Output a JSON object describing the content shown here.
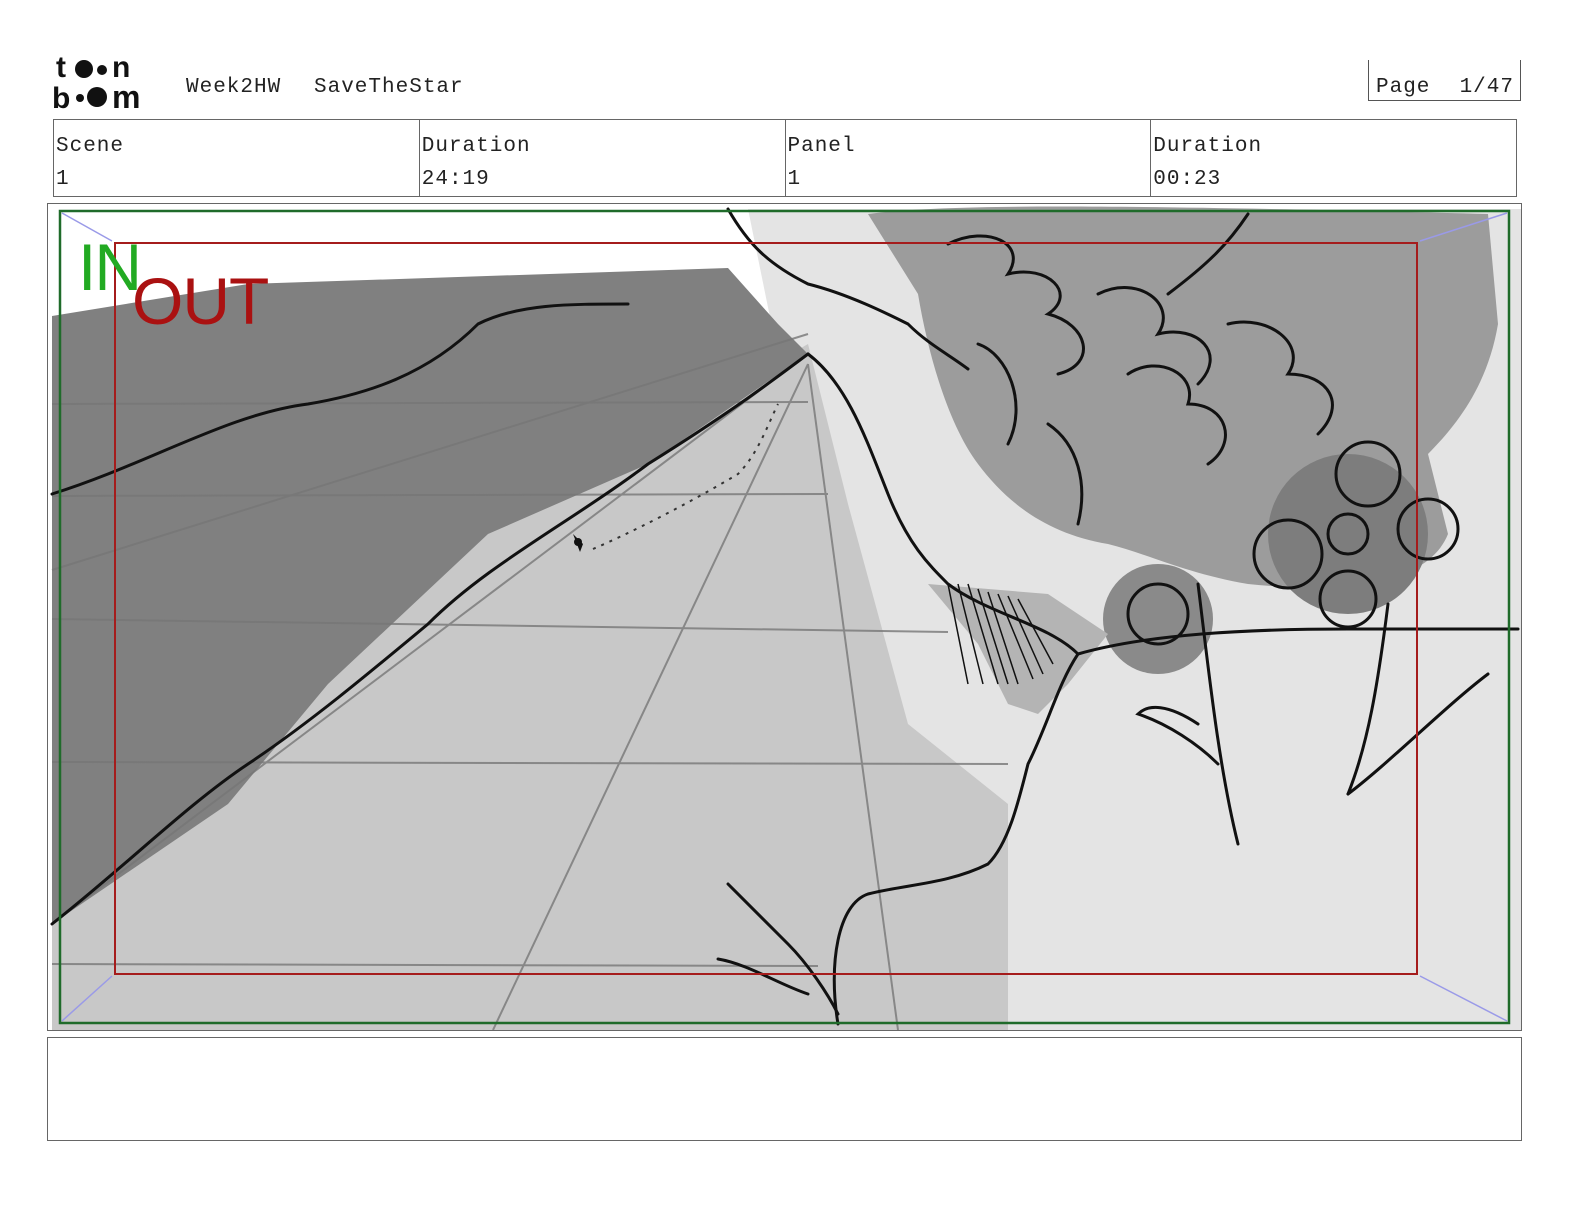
{
  "header": {
    "logo_text_top": "toon",
    "logo_text_bottom": "boom",
    "project": "Week2HW",
    "scene_name": "SaveTheStar",
    "page_label": "Page",
    "page_value": "1/47"
  },
  "info": {
    "scene_label": "Scene",
    "scene_value": "1",
    "scene_duration_label": "Duration",
    "scene_duration_value": "24:19",
    "panel_label": "Panel",
    "panel_value": "1",
    "panel_duration_label": "Duration",
    "panel_duration_value": "00:23"
  },
  "panel": {
    "in_label": "IN",
    "out_label": "OUT",
    "in_color": "#22aa22",
    "out_color": "#aa1111"
  },
  "notes": {
    "text": ""
  }
}
